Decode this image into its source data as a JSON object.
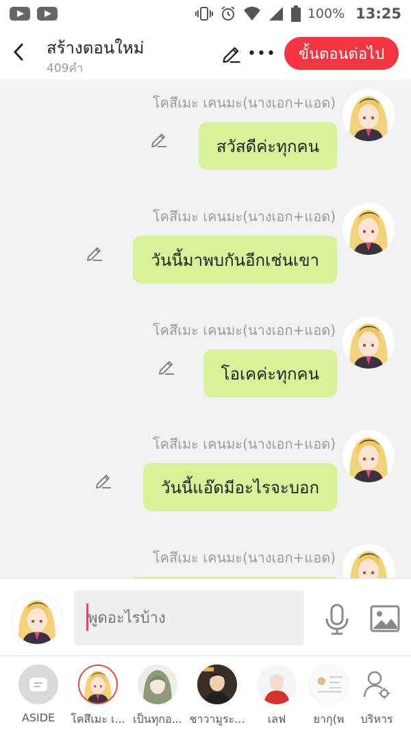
{
  "status": {
    "battery": "100%",
    "time": "13:25"
  },
  "header": {
    "title": "สร้างตอนใหม่",
    "word_count": "409คำ",
    "next_label": "ขั้นตอนต่อไป"
  },
  "messages": [
    {
      "sender": "โคสึเมะ เคนมะ(นางเอก+แอด)",
      "text": "สวัสดีค่ะทุกคน"
    },
    {
      "sender": "โคสึเมะ เคนมะ(นางเอก+แอด)",
      "text": "วันนี้มาพบกันอีกเช่นเขา"
    },
    {
      "sender": "โคสึเมะ เคนมะ(นางเอก+แอด)",
      "text": "โอเคค่ะทุกคน"
    },
    {
      "sender": "โคสึเมะ เคนมะ(นางเอก+แอด)",
      "text": "วันนี้แอ๊ดมีอะไรจะบอก"
    },
    {
      "sender": "โคสึเมะ เคนมะ(นางเอก+แอด)",
      "text": ""
    }
  ],
  "input": {
    "placeholder": "พูดอะไรบ้าง"
  },
  "characters": [
    {
      "label": "ASIDE"
    },
    {
      "label": "โคสึเมะ เ..."
    },
    {
      "label": "เป็นทุกอ..."
    },
    {
      "label": "ชาวามูระ..."
    },
    {
      "label": "เลฟ"
    },
    {
      "label": "ยากุ(พ"
    },
    {
      "label": "บริหาร"
    }
  ],
  "colors": {
    "accent": "#f2363f",
    "bubble": "#d7f297",
    "caret": "#e8457a"
  }
}
